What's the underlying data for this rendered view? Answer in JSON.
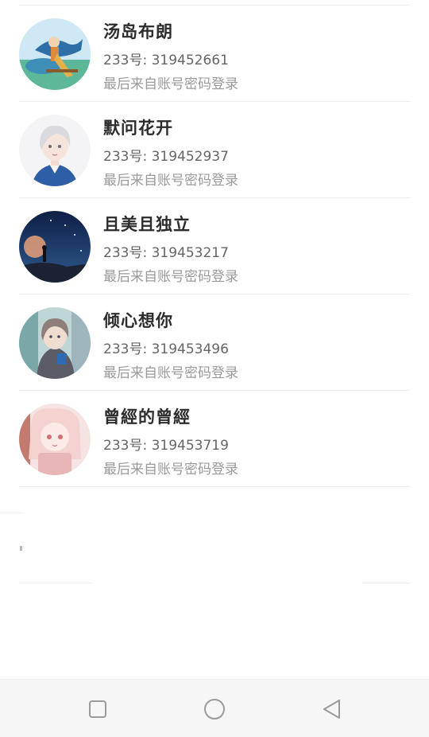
{
  "accounts": [
    {
      "nickname": "汤岛布朗",
      "id_line": "233号: 319452661",
      "login_hint": "最后来自账号密码登录",
      "avatar_icon": "avatar-anime-rider-icon"
    },
    {
      "nickname": "默问花开",
      "id_line": "233号: 319452937",
      "login_hint": "最后来自账号密码登录",
      "avatar_icon": "avatar-white-hair-boy-icon"
    },
    {
      "nickname": "且美且独立",
      "id_line": "233号: 319453217",
      "login_hint": "最后来自账号密码登录",
      "avatar_icon": "avatar-night-sky-icon"
    },
    {
      "nickname": "倾心想你",
      "id_line": "233号: 319453496",
      "login_hint": "最后来自账号密码登录",
      "avatar_icon": "avatar-hooded-girl-icon"
    },
    {
      "nickname": "曾經的曾經",
      "id_line": "233号: 319453719",
      "login_hint": "最后来自账号密码登录",
      "avatar_icon": "avatar-pink-hair-girl-icon"
    }
  ],
  "nav_bar": {
    "recent_icon": "square-recent-apps-icon",
    "home_icon": "circle-home-icon",
    "back_icon": "triangle-back-icon"
  },
  "colors": {
    "nickname": "#2c2c2c",
    "id_text": "#666666",
    "hint_text": "#9a9a9a",
    "divider": "#ececec",
    "nav_background": "#f6f6f6",
    "nav_icon": "#9a9a9a"
  }
}
